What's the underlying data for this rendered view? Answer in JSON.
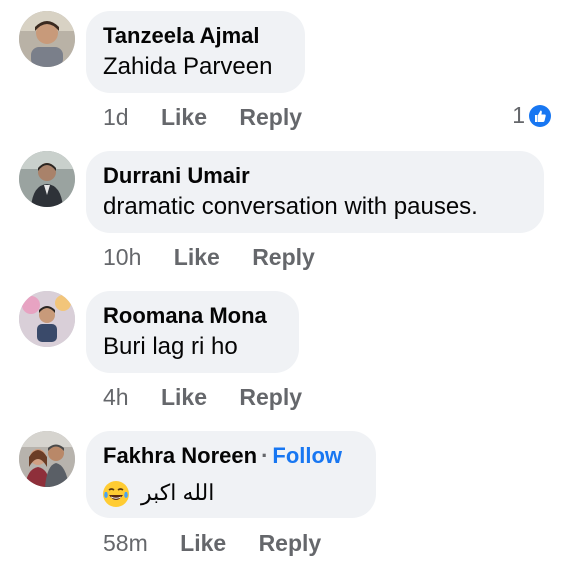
{
  "comments": [
    {
      "author": "Tanzeela Ajmal",
      "text": "Zahida Parveen",
      "time": "1d",
      "like": "Like",
      "reply": "Reply",
      "reaction_count": "1"
    },
    {
      "author": "Durrani Umair",
      "text": "dramatic conversation with pauses.",
      "time": "10h",
      "like": "Like",
      "reply": "Reply"
    },
    {
      "author": "Roomana Mona",
      "text": "Buri lag ri ho",
      "time": "4h",
      "like": "Like",
      "reply": "Reply"
    },
    {
      "author": "Fakhra Noreen",
      "follow": "Follow",
      "separator": "·",
      "text": "الله اکبر",
      "emoji": "laughing-crying-emoji",
      "time": "58m",
      "like": "Like",
      "reply": "Reply"
    }
  ],
  "colors": {
    "bubble": "#f0f2f5",
    "meta": "#65676b",
    "link": "#1877f2",
    "text": "#050505"
  }
}
